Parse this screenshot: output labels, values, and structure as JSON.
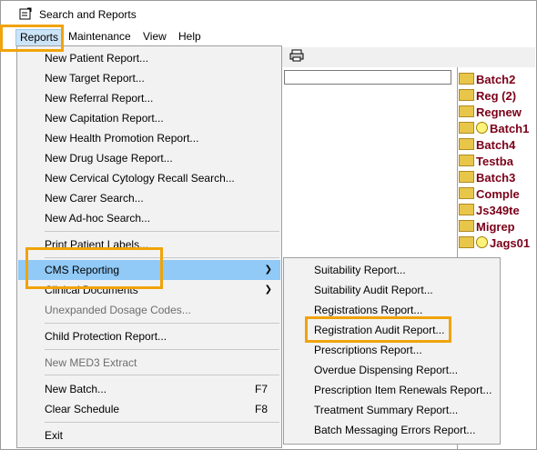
{
  "window": {
    "title": "Search and Reports"
  },
  "menubar": {
    "items": [
      {
        "label": "Reports",
        "active": true
      },
      {
        "label": "Maintenance"
      },
      {
        "label": "View"
      },
      {
        "label": "Help"
      }
    ]
  },
  "background": {
    "folders": [
      {
        "label": "Batch2",
        "clock": false
      },
      {
        "label": "Reg (2)",
        "clock": false
      },
      {
        "label": "Regnew",
        "clock": false
      },
      {
        "label": "Batch1",
        "clock": true
      },
      {
        "label": "Batch4",
        "clock": false
      },
      {
        "label": "Testba",
        "clock": false
      },
      {
        "label": "Batch3",
        "clock": false
      },
      {
        "label": "Comple",
        "clock": false
      },
      {
        "label": "Js349te",
        "clock": false
      },
      {
        "label": "Migrep",
        "clock": false
      },
      {
        "label": "Jags01",
        "clock": true
      }
    ]
  },
  "reports_menu": {
    "items": [
      {
        "label": "New Patient Report..."
      },
      {
        "label": "New Target Report..."
      },
      {
        "label": "New Referral Report..."
      },
      {
        "label": "New Capitation Report..."
      },
      {
        "label": "New Health Promotion Report..."
      },
      {
        "label": "New Drug Usage Report..."
      },
      {
        "label": "New Cervical Cytology Recall Search..."
      },
      {
        "label": "New Carer Search..."
      },
      {
        "label": "New Ad-hoc Search..."
      },
      {
        "label": "Print Patient Labels..."
      },
      {
        "label": "CMS Reporting",
        "submenu": true,
        "selected": true
      },
      {
        "label": "Clinical Documents",
        "submenu": true
      },
      {
        "label": "Unexpanded Dosage Codes...",
        "disabled": true
      },
      {
        "label": "Child Protection Report..."
      },
      {
        "label": "New MED3 Extract",
        "disabled": true
      },
      {
        "label": "New Batch...",
        "shortcut": "F7"
      },
      {
        "label": "Clear Schedule",
        "shortcut": "F8"
      },
      {
        "label": "Exit"
      }
    ]
  },
  "cms_submenu": {
    "items": [
      {
        "label": "Suitability Report..."
      },
      {
        "label": "Suitability Audit Report..."
      },
      {
        "label": "Registrations Report..."
      },
      {
        "label": "Registration Audit Report..."
      },
      {
        "label": "Prescriptions Report..."
      },
      {
        "label": "Overdue Dispensing Report..."
      },
      {
        "label": "Prescription Item Renewals Report..."
      },
      {
        "label": "Treatment Summary Report..."
      },
      {
        "label": "Batch Messaging Errors Report..."
      }
    ]
  },
  "colors": {
    "highlight": "#f0a30a",
    "selection": "#91c9f7",
    "folder_text": "#7b0019"
  },
  "icons": {
    "app": "report-window-icon",
    "printer": "printer-icon",
    "folder": "folder-icon",
    "clock": "clock-icon",
    "submenu": "submenu-arrow-icon"
  }
}
